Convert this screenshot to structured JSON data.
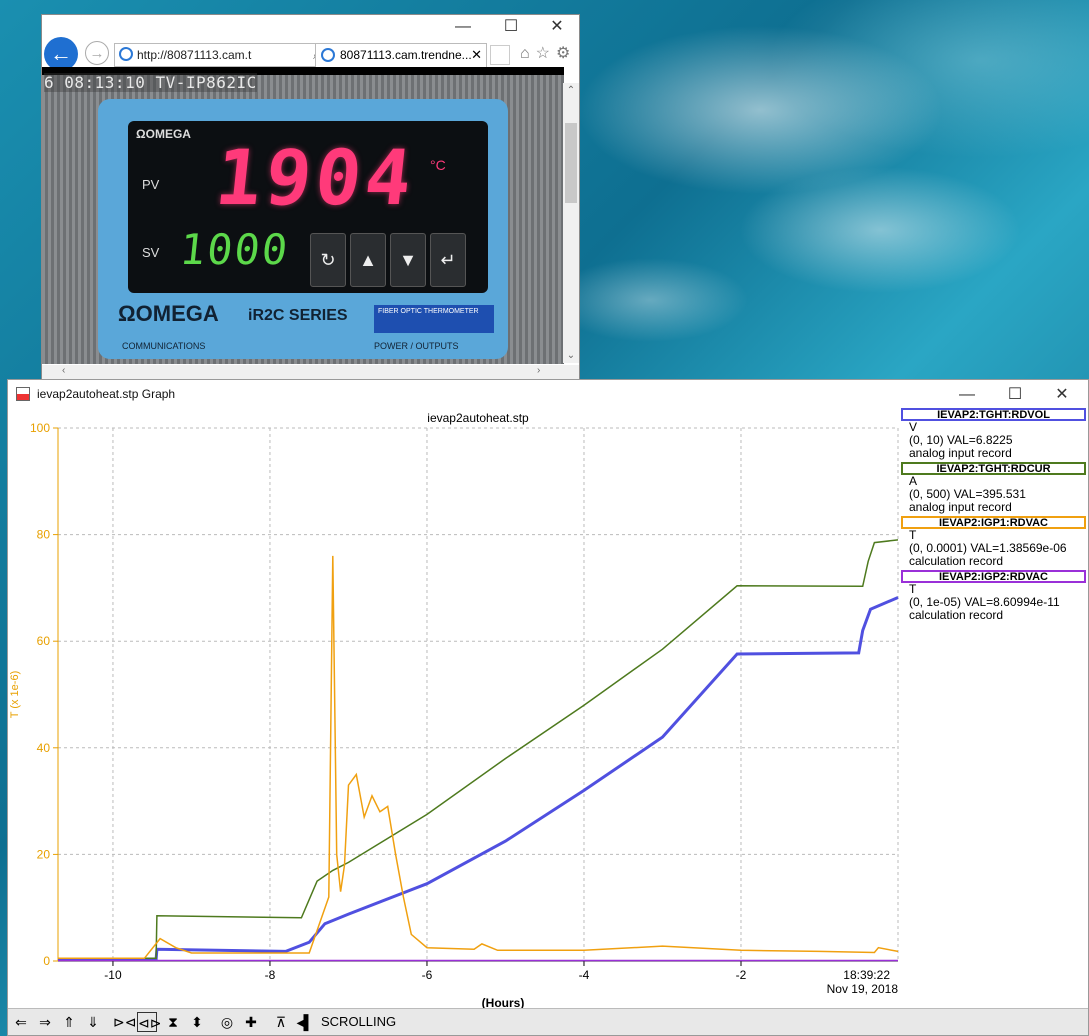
{
  "browser": {
    "address": "http://80871113.cam.t",
    "tab_title": "80871113.cam.trendne...",
    "cam_timestamp": "6 08:13:10 TV-IP862IC",
    "controller": {
      "logo": "ΩOMEGA",
      "pv_label": "PV",
      "sv_label": "SV",
      "pv_value": "1904",
      "pv_unit": "°C",
      "sv_value": "1000",
      "brand": "ΩOMEGA",
      "series": "iR2C SERIES",
      "fiber": "FIBER OPTIC THERMOMETER",
      "communications": "COMMUNICATIONS",
      "power": "POWER / OUTPUTS"
    }
  },
  "graph_window": {
    "title": "ievap2autoheat.stp Graph"
  },
  "legend": [
    {
      "name": "IEVAP2:TGHT:RDVOL",
      "unit": "V",
      "range": "(0, 10) VAL=6.8225",
      "type": "analog input record",
      "color": "#5050e0"
    },
    {
      "name": "IEVAP2:TGHT:RDCUR",
      "unit": "A",
      "range": "(0, 500) VAL=395.531",
      "type": "analog input record",
      "color": "#4e7a1e"
    },
    {
      "name": "IEVAP2:IGP1:RDVAC",
      "unit": "T",
      "range": "(0, 0.0001) VAL=1.38569e-06",
      "type": "calculation record",
      "color": "#f0a010"
    },
    {
      "name": "IEVAP2:IGP2:RDVAC",
      "unit": "T",
      "range": "(0, 1e-05) VAL=8.60994e-11",
      "type": "calculation record",
      "color": "#9a30d8"
    }
  ],
  "toolbar": {
    "mode": "SCROLLING"
  },
  "chart_data": {
    "type": "line",
    "title": "ievap2autoheat.stp",
    "xlabel": "(Hours)",
    "ylabel": "T (x 1e-6)",
    "xlim": [
      -10.7,
      0
    ],
    "ylim": [
      0,
      100
    ],
    "x_ticks": [
      -10,
      -8,
      -6,
      -4,
      -2
    ],
    "y_ticks": [
      0,
      20,
      40,
      60,
      80,
      100
    ],
    "end_time": "18:39:22",
    "end_date": "Nov 19, 2018",
    "grid": true,
    "series": [
      {
        "name": "IEVAP2:TGHT:RDVOL",
        "color": "#5050e0",
        "x": [
          -10.7,
          -9.45,
          -9.44,
          -7.8,
          -7.5,
          -7.3,
          -7.0,
          -6.0,
          -5.0,
          -4.0,
          -3.0,
          -2.05,
          -0.5,
          -0.45,
          -0.35,
          0
        ],
        "y": [
          0.3,
          0.3,
          2.2,
          1.8,
          3.5,
          7.0,
          8.8,
          14.5,
          22.5,
          32.0,
          42.0,
          57.6,
          57.8,
          62.0,
          66.0,
          68.2
        ]
      },
      {
        "name": "IEVAP2:TGHT:RDCUR",
        "color": "#4e7a1e",
        "x": [
          -10.7,
          -9.45,
          -9.44,
          -7.6,
          -7.4,
          -7.2,
          -7.0,
          -6.0,
          -5.0,
          -4.0,
          -3.0,
          -2.05,
          -0.45,
          -0.38,
          -0.3,
          0
        ],
        "y": [
          0.5,
          0.5,
          8.5,
          8.1,
          15.0,
          17.0,
          18.5,
          27.5,
          38.0,
          48.0,
          58.5,
          70.4,
          70.3,
          75.0,
          78.5,
          79.0
        ]
      },
      {
        "name": "IEVAP2:IGP1:RDVAC",
        "color": "#f0a010",
        "x": [
          -10.7,
          -9.6,
          -9.4,
          -9.2,
          -9.0,
          -7.5,
          -7.25,
          -7.2,
          -7.15,
          -7.1,
          -7.05,
          -7.0,
          -6.9,
          -6.8,
          -6.7,
          -6.6,
          -6.5,
          -6.4,
          -6.3,
          -6.2,
          -6.0,
          -5.4,
          -5.3,
          -5.1,
          -4.0,
          -3.0,
          -2.0,
          -1.0,
          -0.3,
          -0.25,
          0
        ],
        "y": [
          0.5,
          0.5,
          4.2,
          2.5,
          1.5,
          1.5,
          12.0,
          76.0,
          20.0,
          13.0,
          18.0,
          33.0,
          35.0,
          27.0,
          31.0,
          28.0,
          29.0,
          20.0,
          12.0,
          5.0,
          2.5,
          2.2,
          3.2,
          2.0,
          2.0,
          2.8,
          2.0,
          1.8,
          1.6,
          2.5,
          1.8
        ]
      },
      {
        "name": "IEVAP2:IGP2:RDVAC",
        "color": "#9a30d8",
        "x": [
          -10.7,
          0
        ],
        "y": [
          0.1,
          0.1
        ]
      }
    ]
  }
}
